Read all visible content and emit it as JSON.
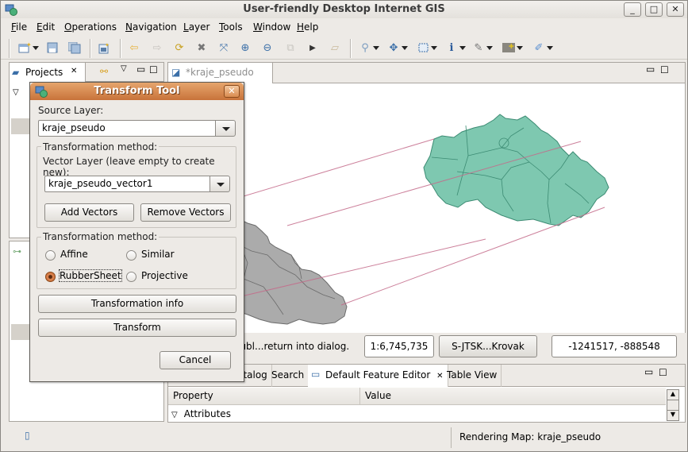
{
  "window": {
    "title": "User-friendly Desktop Internet GIS",
    "controls": {
      "minimize": "_",
      "maximize": "□",
      "close": "✕"
    }
  },
  "menubar": {
    "items": [
      {
        "label": "File",
        "mnemonic": "F"
      },
      {
        "label": "Edit",
        "mnemonic": "E"
      },
      {
        "label": "Operations",
        "mnemonic": "O"
      },
      {
        "label": "Navigation",
        "mnemonic": "N"
      },
      {
        "label": "Layer",
        "mnemonic": "L"
      },
      {
        "label": "Tools",
        "mnemonic": "T"
      },
      {
        "label": "Window",
        "mnemonic": "W"
      },
      {
        "label": "Help",
        "mnemonic": "H"
      }
    ]
  },
  "toolbar": {
    "icons": [
      "new-project-icon",
      "save-icon",
      "save-all-icon",
      "new-layer-icon",
      "back-icon",
      "forward-icon",
      "refresh-icon",
      "stop-render-icon",
      "zoom-extent-icon",
      "zoom-in-icon",
      "zoom-out-icon",
      "pan-disabled-icon",
      "next-icon",
      "eraser-icon",
      "zoom-tool-icon",
      "pan-tool-icon",
      "select-tool-icon",
      "info-tool-icon",
      "edit-tool-icon",
      "grid-tool-icon",
      "pin-tool-icon"
    ]
  },
  "projects_panel": {
    "tab_label": "Projects",
    "close_glyph": "✕"
  },
  "map_editor": {
    "tab_label": "*kraje_pseudo",
    "colors": {
      "target": "#7ec8b0",
      "target_border": "#3c8b73",
      "source": "#ababab",
      "source_border": "#6b6b6b",
      "vector": "#c46b8a"
    }
  },
  "map_status": {
    "message": "...ubl...return into dialog.",
    "scale": "1:6,745,735",
    "crs": "S-JTSK...Krovak",
    "coords": "-1241517, -888548"
  },
  "bottom_panel": {
    "tabs": [
      {
        "label": "...talog"
      },
      {
        "label": "Search"
      },
      {
        "label": "Default Feature Editor",
        "active": true
      },
      {
        "label": "Table View"
      }
    ],
    "columns": [
      "Property",
      "Value"
    ],
    "rows": [
      {
        "label": "Attributes",
        "expanded": true
      }
    ]
  },
  "statusbar": {
    "message": "Rendering Map: kraje_pseudo"
  },
  "dialog": {
    "title": "Transform Tool",
    "source_layer_label": "Source Layer:",
    "source_layer_value": "kraje_pseudo",
    "group1_title": "Transformation method:",
    "vector_layer_label": "Vector Layer (leave empty to create new):",
    "vector_layer_value": "kraje_pseudo_vector1",
    "add_vectors": "Add Vectors",
    "remove_vectors": "Remove Vectors",
    "group2_title": "Transformation method:",
    "methods": [
      {
        "label": "Affine",
        "selected": false
      },
      {
        "label": "Similar",
        "selected": false
      },
      {
        "label": "RubberSheet",
        "selected": true
      },
      {
        "label": "Projective",
        "selected": false
      }
    ],
    "transformation_info": "Transformation info",
    "transform": "Transform",
    "cancel": "Cancel"
  }
}
